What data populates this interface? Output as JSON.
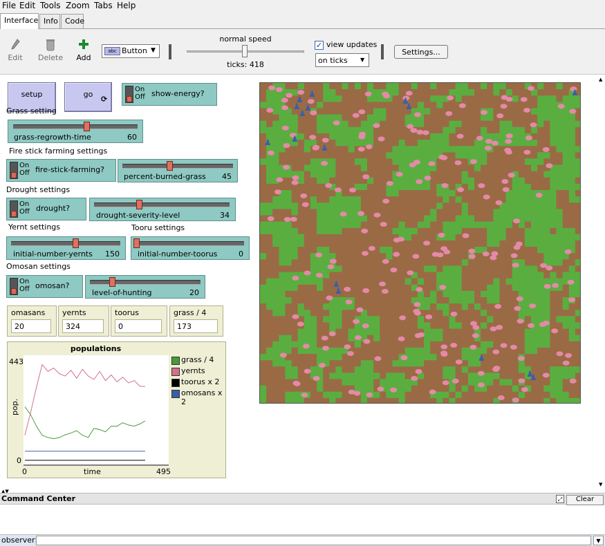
{
  "menubar": [
    "File",
    "Edit",
    "Tools",
    "Zoom",
    "Tabs",
    "Help"
  ],
  "tabs": [
    "Interface",
    "Info",
    "Code"
  ],
  "toolbar": {
    "edit": "Edit",
    "delete": "Delete",
    "add": "Add",
    "widget_type": "Button",
    "speed_label": "normal speed",
    "ticks": "ticks: 418",
    "view_updates": "view updates",
    "update_mode": "on ticks",
    "settings": "Settings..."
  },
  "buttons": {
    "setup": "setup",
    "go": "go"
  },
  "switch_on": "On",
  "switch_off": "Off",
  "switches": {
    "show_energy": "show-energy?",
    "fire_stick": "fire-stick-farming?",
    "drought": "drought?",
    "omosan": "omosan?"
  },
  "labels": {
    "grass": "Grass setting",
    "fire": "Fire stick farming settings",
    "drought": "Drought settings",
    "yernt": "Yernt settings",
    "tooru": "Tooru settings",
    "omosan": "Omosan settings"
  },
  "sliders": [
    {
      "name": "grass-regrowth-time",
      "value": "60",
      "fraction": 0.62
    },
    {
      "name": "percent-burned-grass",
      "value": "45",
      "fraction": 0.45
    },
    {
      "name": "drought-severity-level",
      "value": "34",
      "fraction": 0.34
    },
    {
      "name": "initial-number-yernts",
      "value": "150",
      "fraction": 0.55
    },
    {
      "name": "initial-number-toorus",
      "value": "0",
      "fraction": 0.0
    },
    {
      "name": "level-of-hunting",
      "value": "20",
      "fraction": 0.2
    }
  ],
  "monitors": [
    {
      "label": "omasans",
      "value": "20"
    },
    {
      "label": "yernts",
      "value": "324"
    },
    {
      "label": "toorus",
      "value": "0"
    },
    {
      "label": "grass / 4",
      "value": "173"
    }
  ],
  "plot": {
    "title": "populations",
    "ymax": "443",
    "ymin": "0",
    "xmin": "0",
    "xmax": "495",
    "xlabel": "time",
    "ylabel": "pop."
  },
  "chart_data": {
    "type": "line",
    "title": "populations",
    "xlabel": "time",
    "ylabel": "pop.",
    "xlim": [
      0,
      495
    ],
    "ylim": [
      0,
      443
    ],
    "legend": "right",
    "series": [
      {
        "name": "grass / 4",
        "color": "#4a9a3a",
        "x": [
          0,
          20,
          40,
          60,
          80,
          100,
          120,
          140,
          160,
          180,
          200,
          220,
          240,
          260,
          280,
          300,
          320,
          340,
          360,
          380,
          400,
          418
        ],
        "y": [
          235,
          200,
          150,
          110,
          100,
          95,
          100,
          112,
          120,
          130,
          110,
          100,
          140,
          135,
          125,
          150,
          150,
          165,
          155,
          150,
          160,
          173
        ]
      },
      {
        "name": "yernts",
        "color": "#d4708a",
        "x": [
          0,
          20,
          40,
          60,
          80,
          100,
          120,
          140,
          160,
          180,
          200,
          220,
          240,
          260,
          280,
          300,
          320,
          340,
          360,
          380,
          400,
          418
        ],
        "y": [
          110,
          210,
          320,
          420,
          390,
          405,
          380,
          370,
          395,
          360,
          400,
          370,
          355,
          390,
          350,
          375,
          345,
          365,
          340,
          350,
          325,
          324
        ]
      },
      {
        "name": "toorus x 2",
        "color": "#000000",
        "x": [
          0,
          418
        ],
        "y": [
          0,
          0
        ]
      },
      {
        "name": "omosans x 2",
        "color": "#3a5fa8",
        "x": [
          0,
          418
        ],
        "y": [
          40,
          40
        ]
      }
    ]
  },
  "command_center": {
    "title": "Command Center",
    "clear": "Clear",
    "prompt": "observer>"
  }
}
